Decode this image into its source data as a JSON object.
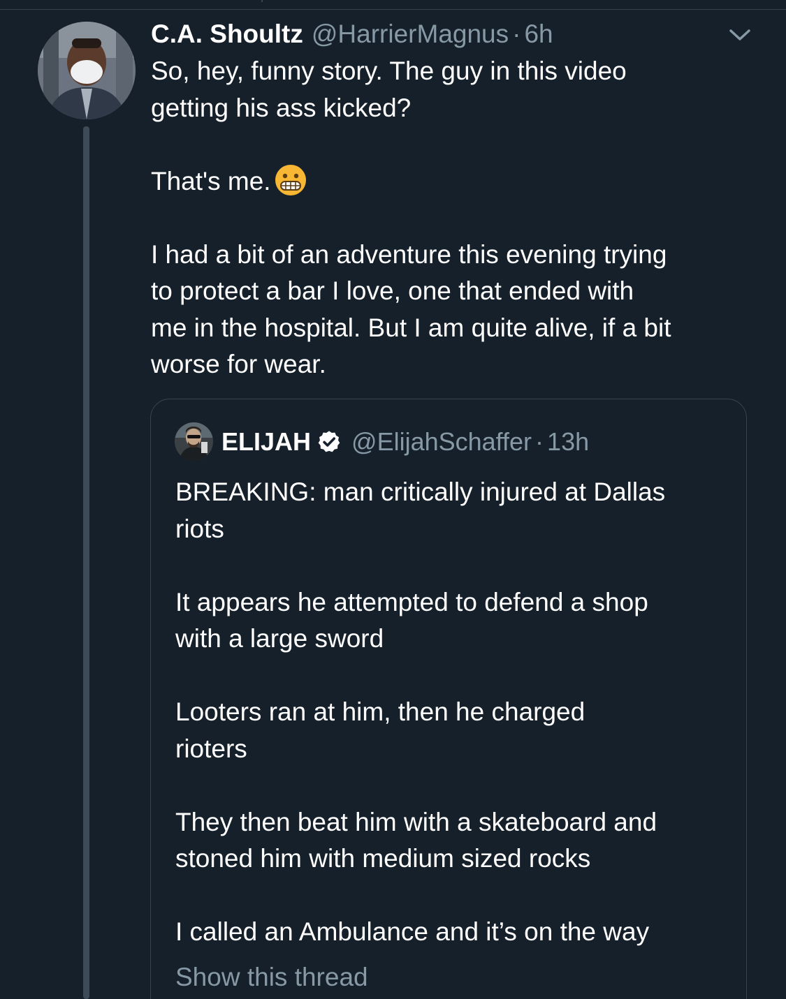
{
  "tweet": {
    "author": {
      "display_name": "C.A. Shoultz",
      "handle": "@HarrierMagnus",
      "separator": "·",
      "timestamp": "6h"
    },
    "menu_icon": "chevron-down-icon",
    "paragraphs": [
      {
        "lines": [
          "So, hey, funny story. The guy in this video",
          "getting his ass kicked?"
        ]
      },
      {
        "lines": [
          "That's me."
        ],
        "emoji": "grimacing-face-emoji"
      },
      {
        "lines": [
          "I had a bit of an adventure this evening trying",
          "to protect a bar I love, one that ended with",
          "me in the hospital. But I am quite alive, if a bit",
          "worse for wear."
        ]
      }
    ]
  },
  "quoted_tweet": {
    "author": {
      "display_name": "ELIJAH",
      "verified_icon": "verified-badge-icon",
      "handle": "@ElijahSchaffer",
      "separator": "·",
      "timestamp": "13h"
    },
    "paragraphs": [
      [
        "BREAKING: man critically injured at Dallas",
        "riots"
      ],
      [
        "It appears he attempted to defend a shop",
        "with a large sword"
      ],
      [
        "Looters ran at him, then he charged",
        "rioters"
      ],
      [
        "They then beat him with a skateboard and",
        "stoned him with medium sized rocks"
      ],
      [
        "I called an Ambulance and it’s on the way"
      ]
    ],
    "show_thread_label": "Show this thread"
  },
  "colors": {
    "background": "#15202b",
    "primary_text": "#ffffff",
    "secondary_text": "#8899a6",
    "border": "#38444d",
    "thread_line": "#3d4b58"
  }
}
